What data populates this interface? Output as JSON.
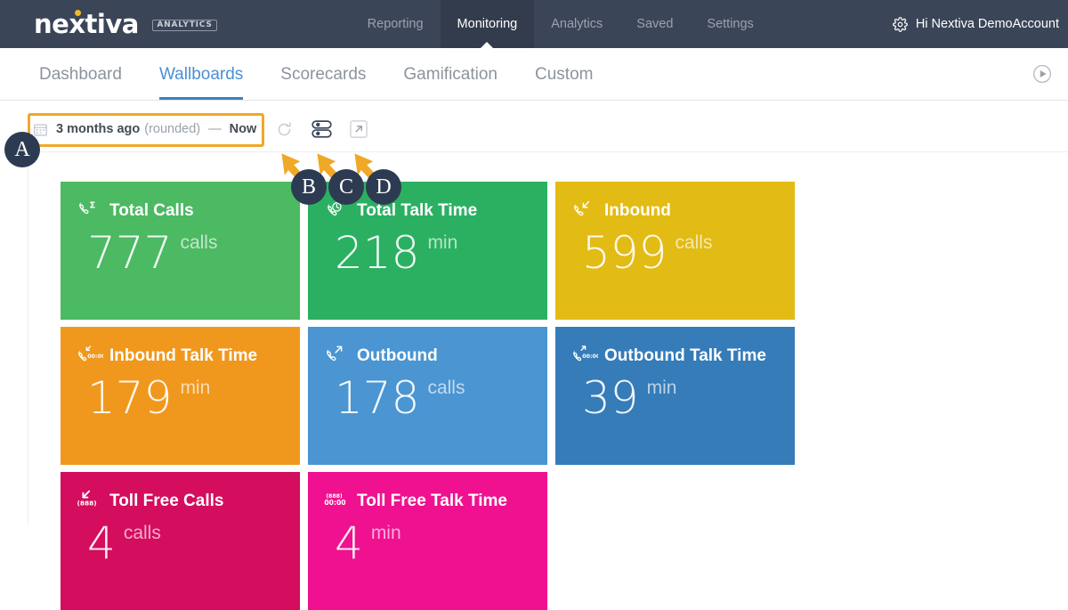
{
  "header": {
    "brand_name": "nextiva",
    "brand_tag": "ANALYTICS",
    "nav": [
      {
        "label": "Reporting",
        "active": false
      },
      {
        "label": "Monitoring",
        "active": true
      },
      {
        "label": "Analytics",
        "active": false
      },
      {
        "label": "Saved",
        "active": false
      },
      {
        "label": "Settings",
        "active": false
      }
    ],
    "account_label": "Hi Nextiva DemoAccount",
    "gear_icon": "gear-icon",
    "brand_color": "#3a4557"
  },
  "subnav": {
    "tabs": [
      {
        "label": "Dashboard",
        "active": false
      },
      {
        "label": "Wallboards",
        "active": true
      },
      {
        "label": "Scorecards",
        "active": false
      },
      {
        "label": "Gamification",
        "active": false
      },
      {
        "label": "Custom",
        "active": false
      }
    ],
    "play_icon": "play-circle-icon",
    "active_color": "#3d7fc4"
  },
  "toolbar": {
    "calendar_icon": "calendar-icon",
    "range_start": "3 months ago",
    "range_rounded": "(rounded)",
    "range_dash": "—",
    "range_end": "Now",
    "refresh_icon": "refresh-icon",
    "layout_icon": "rows-layout-icon",
    "fullscreen_icon": "open-external-icon",
    "highlight_color": "#f0a828"
  },
  "tiles": [
    {
      "title": "Total Calls",
      "value": "777",
      "unit": "calls",
      "color": "#4cb963",
      "icon": "phone-sigma-icon"
    },
    {
      "title": "Total Talk Time",
      "value": "218",
      "unit": "min",
      "color": "#2bb062",
      "icon": "phone-clock-icon"
    },
    {
      "title": "Inbound",
      "value": "599",
      "unit": "calls",
      "color": "#e2bb15",
      "icon": "phone-inbound-icon"
    },
    {
      "title": "Inbound Talk Time",
      "value": "179",
      "unit": "min",
      "color": "#f0981e",
      "icon": "phone-inbound-time-icon"
    },
    {
      "title": "Outbound",
      "value": "178",
      "unit": "calls",
      "color": "#4a95d2",
      "icon": "phone-outbound-icon"
    },
    {
      "title": "Outbound Talk Time",
      "value": "39",
      "unit": "min",
      "color": "#357cb8",
      "icon": "phone-outbound-time-icon"
    },
    {
      "title": "Toll Free Calls",
      "value": "4",
      "unit": "calls",
      "color": "#d40d5e",
      "icon": "tollfree-inbound-icon"
    },
    {
      "title": "Toll Free Talk Time",
      "value": "4",
      "unit": "min",
      "color": "#ef118f",
      "icon": "tollfree-time-icon"
    }
  ],
  "annotations": {
    "markers": [
      {
        "label": "A"
      },
      {
        "label": "B"
      },
      {
        "label": "C"
      },
      {
        "label": "D"
      }
    ],
    "marker_color": "#2d3b52",
    "arrow_color": "#f0a828"
  },
  "tollfree_glyphs": {
    "area_code": "(888)",
    "time": "00:00"
  }
}
